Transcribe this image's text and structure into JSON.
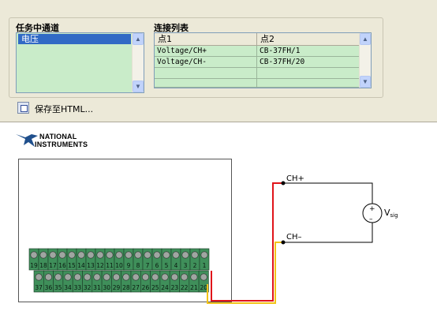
{
  "channels": {
    "title": "任务中通道",
    "items": [
      "电压"
    ]
  },
  "connections": {
    "title": "连接列表",
    "columns": [
      "点1",
      "点2"
    ],
    "rows": [
      [
        "Voltage/CH+",
        "CB-37FH/1"
      ],
      [
        "Voltage/CH-",
        "CB-37FH/20"
      ]
    ]
  },
  "save": {
    "label": "保存至HTML..."
  },
  "logo": {
    "line1": "NATIONAL",
    "line2": "INSTRUMENTS"
  },
  "diagram": {
    "ch_plus": "CH+",
    "ch_minus": "CH–",
    "source_label": "V",
    "source_sub": "sig",
    "plus_sign": "+",
    "minus_sign": "–",
    "top_pins": [
      "19",
      "18",
      "17",
      "16",
      "15",
      "14",
      "13",
      "12",
      "11",
      "10",
      "9",
      "8",
      "7",
      "6",
      "5",
      "4",
      "3",
      "2",
      "1"
    ],
    "bottom_pins": [
      "37",
      "36",
      "35",
      "34",
      "33",
      "32",
      "31",
      "30",
      "29",
      "28",
      "27",
      "26",
      "25",
      "24",
      "23",
      "22",
      "21",
      "20"
    ]
  },
  "colors": {
    "wire_red": "#e0141a",
    "wire_yellow": "#f2c318",
    "terminal_green": "#3f8f5a",
    "list_bg": "#c9ecc9",
    "selection": "#316ac5"
  }
}
